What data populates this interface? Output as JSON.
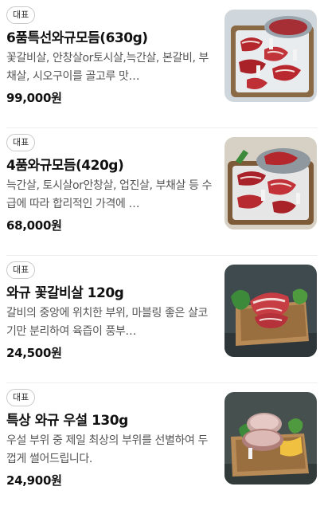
{
  "menu": {
    "items": [
      {
        "badge": "대표",
        "name": "6품특선와규모듬(630g)",
        "description": "꽃갈비살, 안창살or토시살,늑간살, 본갈비, 부채살, 시오구이를 골고루 맛…",
        "price": "99,000원",
        "image_icon": "wagyu-platter-6-cuts"
      },
      {
        "badge": "대표",
        "name": "4품와규모듬(420g)",
        "description": "늑간살, 토시살or안창살, 업진살, 부채살 등 수급에 따라 합리적인 가격에 …",
        "price": "68,000원",
        "image_icon": "wagyu-platter-4-cuts"
      },
      {
        "badge": "대표",
        "name": "와규 꽃갈비살 120g",
        "description": "갈비의 중앙에 위치한 부위, 마블링 좋은 살코기만 분리하여 육즙이 풍부…",
        "price": "24,500원",
        "image_icon": "wagyu-rib-box"
      },
      {
        "badge": "대표",
        "name": "특상 와규 우설 130g",
        "description": "우설 부위 중 제일 최상의 부위를 선별하여 두껍게 썰어드립니다.",
        "price": "24,900원",
        "image_icon": "wagyu-tongue-box"
      }
    ]
  },
  "colors": {
    "meat": "#b3272d",
    "marbling": "#f1d9d6",
    "wood": "#b88a55",
    "greens": "#3c8a3a",
    "divider": "#ededed"
  }
}
